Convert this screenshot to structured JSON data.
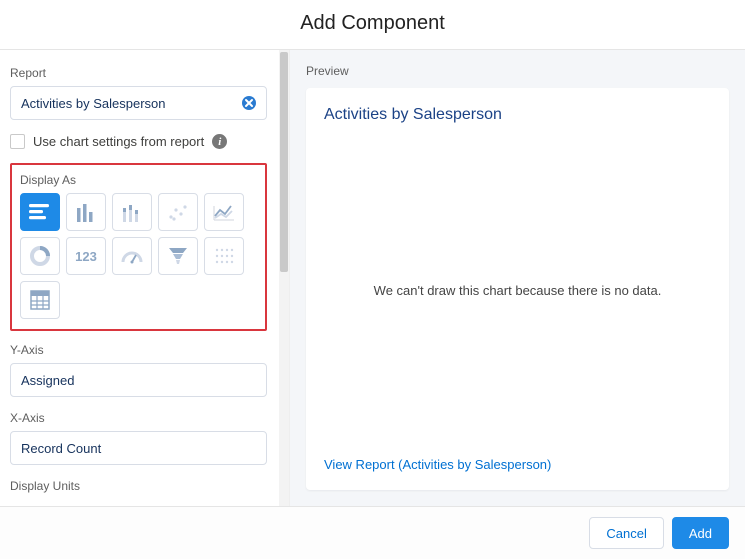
{
  "header": {
    "title": "Add Component"
  },
  "left": {
    "report_label": "Report",
    "report_value": "Activities by Salesperson",
    "use_chart_settings_label": "Use chart settings from report",
    "use_chart_settings_checked": false,
    "display_as_label": "Display As",
    "chart_types": [
      {
        "name": "horizontal-bar",
        "selected": true
      },
      {
        "name": "vertical-bar",
        "selected": false
      },
      {
        "name": "stacked-bar",
        "selected": false
      },
      {
        "name": "scatter",
        "selected": false
      },
      {
        "name": "line",
        "selected": false
      },
      {
        "name": "donut",
        "selected": false
      },
      {
        "name": "metric",
        "selected": false
      },
      {
        "name": "gauge",
        "selected": false
      },
      {
        "name": "funnel",
        "selected": false
      },
      {
        "name": "heatmap",
        "selected": false
      },
      {
        "name": "table",
        "selected": false
      }
    ],
    "y_axis_label": "Y-Axis",
    "y_axis_value": "Assigned",
    "x_axis_label": "X-Axis",
    "x_axis_value": "Record Count",
    "display_units_label": "Display Units"
  },
  "preview": {
    "section_label": "Preview",
    "title": "Activities by Salesperson",
    "empty_message": "We can't draw this chart because there is no data.",
    "view_report_text": "View Report (Activities by Salesperson)"
  },
  "footer": {
    "cancel_label": "Cancel",
    "add_label": "Add"
  }
}
